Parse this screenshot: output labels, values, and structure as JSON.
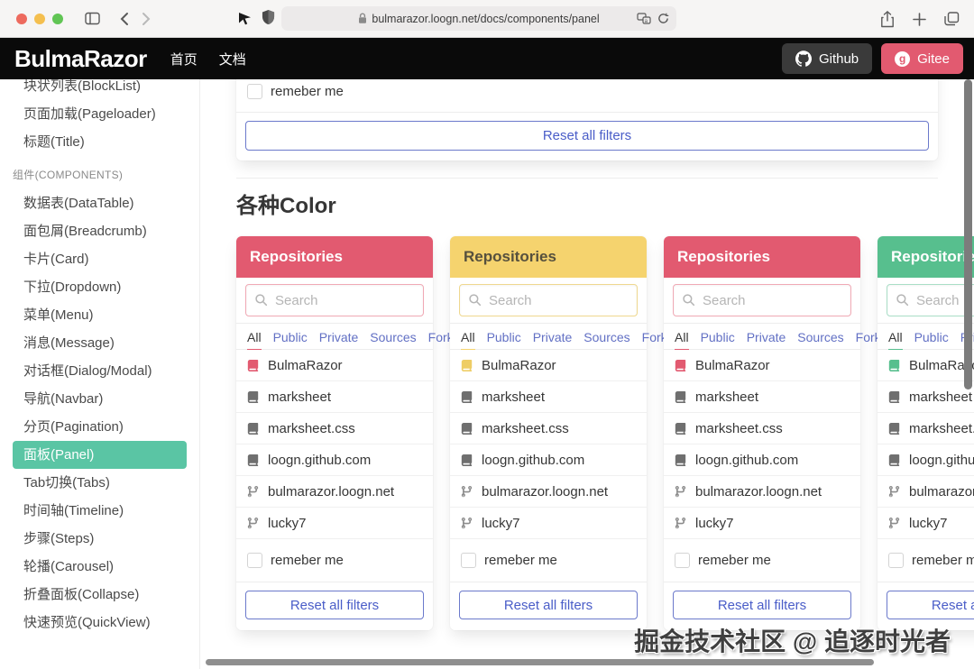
{
  "browser": {
    "url": "bulmarazor.loogn.net/docs/components/panel"
  },
  "navbar": {
    "brand": "BulmaRazor",
    "links": [
      "首页",
      "文档"
    ],
    "github_label": "Github",
    "gitee_label": "Gitee",
    "gitee_color": "#e25a70",
    "github_bg": "#3a3a3a"
  },
  "sidebar": {
    "active_color": "#5ac5a4",
    "items": [
      {
        "label": "块状列表(BlockList)"
      },
      {
        "label": "页面加载(Pageloader)"
      },
      {
        "label": "标题(Title)"
      },
      {
        "label": "组件(COMPONENTS)",
        "section": true
      },
      {
        "label": "数据表(DataTable)"
      },
      {
        "label": "面包屑(Breadcrumb)"
      },
      {
        "label": "卡片(Card)"
      },
      {
        "label": "下拉(Dropdown)"
      },
      {
        "label": "菜单(Menu)"
      },
      {
        "label": "消息(Message)"
      },
      {
        "label": "对话框(Dialog/Modal)"
      },
      {
        "label": "导航(Navbar)"
      },
      {
        "label": "分页(Pagination)"
      },
      {
        "label": "面板(Panel)",
        "active": true
      },
      {
        "label": "Tab切换(Tabs)"
      },
      {
        "label": "时间轴(Timeline)"
      },
      {
        "label": "步骤(Steps)"
      },
      {
        "label": "轮播(Carousel)"
      },
      {
        "label": "折叠面板(Collapse)"
      },
      {
        "label": "快速预览(QuickView)"
      }
    ]
  },
  "content": {
    "heading": "各种Color",
    "top_panel": {
      "checkbox_label": "remeber me",
      "reset_label": "Reset all filters"
    },
    "panel_template": {
      "title": "Repositories",
      "search_placeholder": "Search",
      "tabs": [
        "All",
        "Public",
        "Private",
        "Sources",
        "Forks"
      ],
      "active_tab": "All",
      "items": [
        {
          "label": "BulmaRazor",
          "icon": "book-icon",
          "colored": true
        },
        {
          "label": "marksheet",
          "icon": "book-icon"
        },
        {
          "label": "marksheet.css",
          "icon": "book-icon"
        },
        {
          "label": "loogn.github.com",
          "icon": "book-icon"
        },
        {
          "label": "bulmarazor.loogn.net",
          "icon": "fork-icon"
        },
        {
          "label": "lucky7",
          "icon": "fork-icon"
        }
      ],
      "checkbox_label": "remeber me",
      "reset_label": "Reset all filters"
    },
    "panels": [
      {
        "variant": "danger",
        "header_bg": "#e25a70",
        "header_color": "#ffffff",
        "input_border": "#f0a9b5",
        "first_icon": "#e25a70"
      },
      {
        "variant": "warning",
        "header_bg": "#f5d36e",
        "header_color": "#56503d",
        "input_border": "#efd88f",
        "first_icon": "#eecd66"
      },
      {
        "variant": "danger",
        "header_bg": "#e25a70",
        "header_color": "#ffffff",
        "input_border": "#f0a9b5",
        "first_icon": "#e25a70"
      },
      {
        "variant": "success",
        "header_bg": "#57bf8e",
        "header_color": "#ffffff",
        "input_border": "#a9dec6",
        "first_icon": "#57bf8e"
      }
    ]
  },
  "watermark": "掘金技术社区 @ 追逐时光者"
}
